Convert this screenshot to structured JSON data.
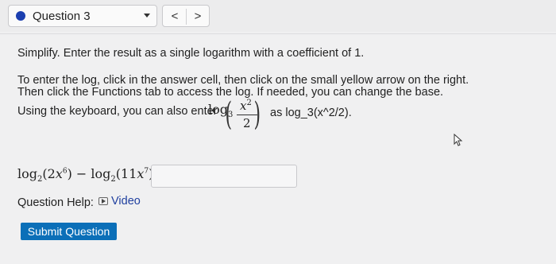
{
  "header": {
    "question_label": "Question 3",
    "prev_label": "<",
    "next_label": ">"
  },
  "content": {
    "instruction1": "Simplify. Enter the result as a single logarithm with a coefficient of 1.",
    "instruction2_line1": "To enter the log, click in the answer cell, then click on the small yellow arrow on the right.",
    "instruction2_line2": "Then click the Functions tab to access the log. If needed, you can change the base.",
    "keyboard_prefix": "Using the keyboard, you can also enter",
    "math_log": "log",
    "math_base": "3",
    "frac_num": "x",
    "frac_num_exp": "2",
    "frac_den": "2",
    "keyboard_suffix": "as log_3(x^2/2).",
    "expression": {
      "log": "log",
      "base": "2",
      "arg1_coef": "2",
      "arg1_var": "x",
      "arg1_exp": "6",
      "arg2_coef": "11",
      "arg2_var": "x",
      "arg2_exp": "7",
      "minus": "−",
      "equals": "="
    },
    "answer_value": "",
    "help_label": "Question Help:",
    "video_label": "Video",
    "submit_label": "Submit Question"
  },
  "colors": {
    "accent": "#1b3fb0",
    "submit_bg": "#0b6fb8",
    "link": "#1f3f9f"
  }
}
